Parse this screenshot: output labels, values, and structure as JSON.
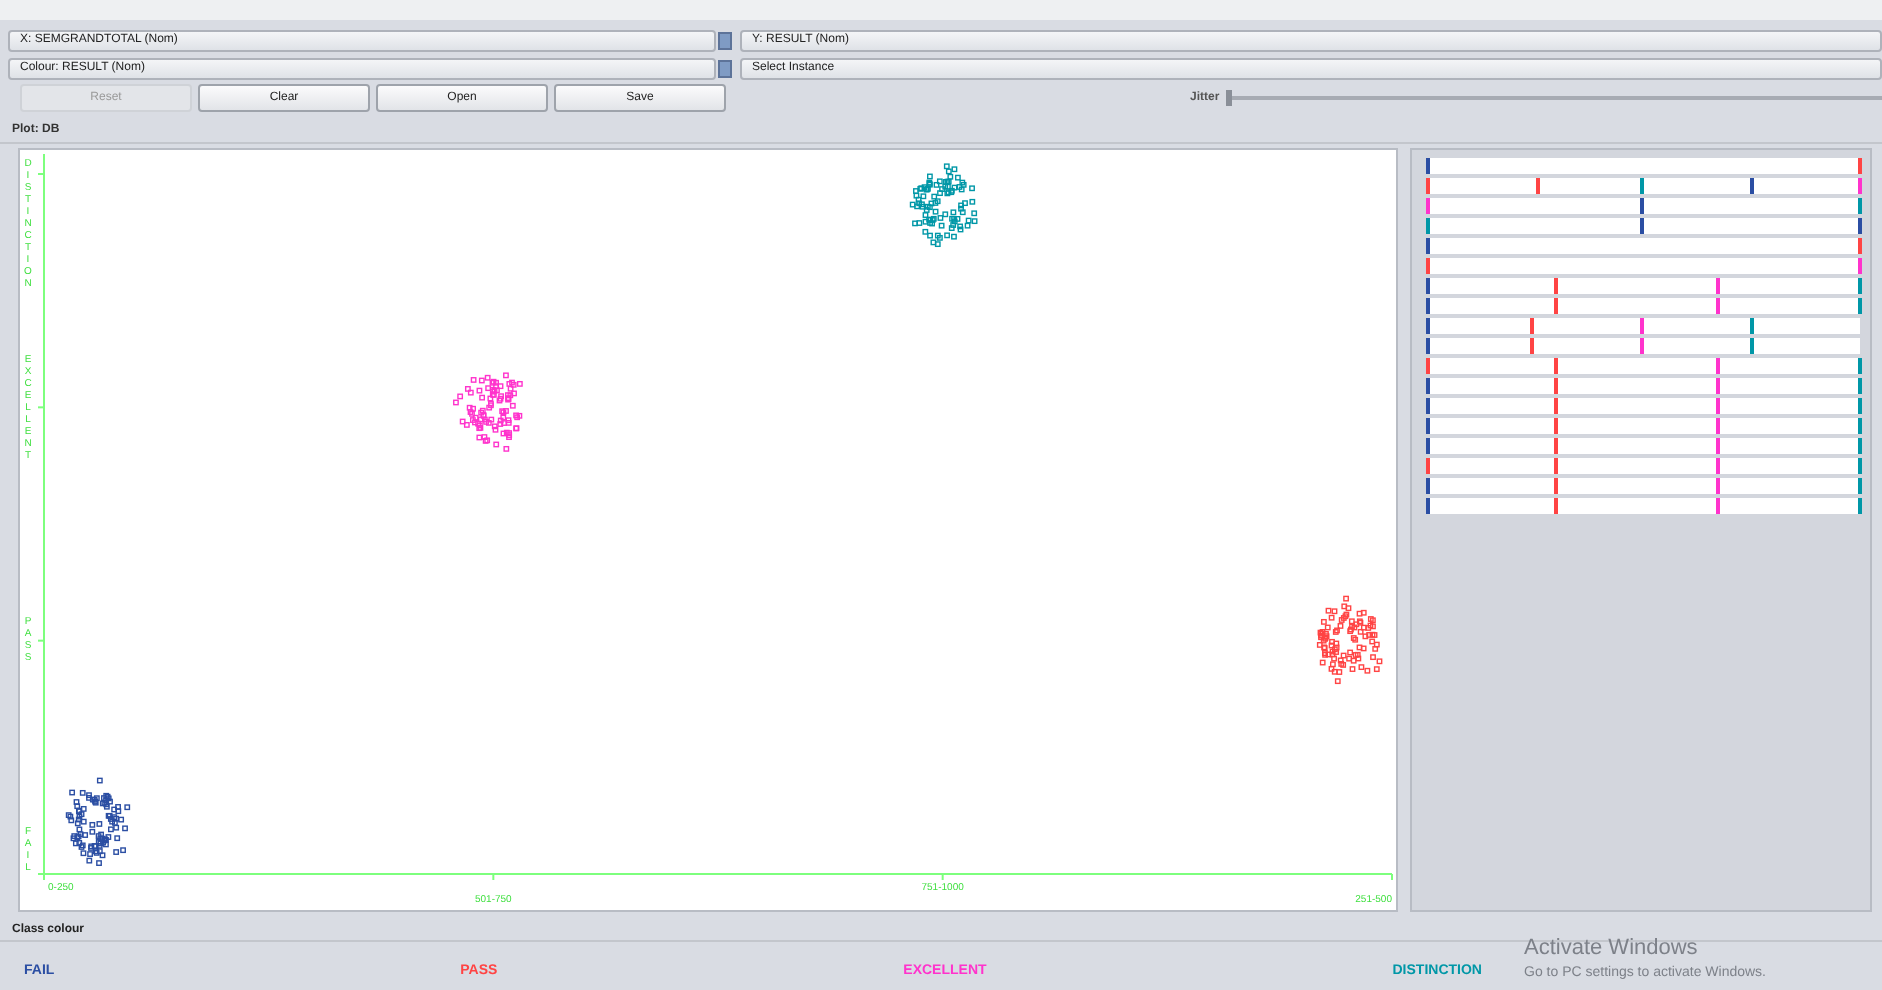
{
  "controls": {
    "x_axis": "X: SEMGRANDTOTAL (Nom)",
    "y_axis": "Y: RESULT (Nom)",
    "colour": "Colour: RESULT (Nom)",
    "instance": "Select Instance"
  },
  "buttons": [
    {
      "label": "Reset",
      "disabled": true
    },
    {
      "label": "Clear",
      "disabled": false
    },
    {
      "label": "Open",
      "disabled": false
    },
    {
      "label": "Save",
      "disabled": false
    }
  ],
  "jitter": {
    "label": "Jitter",
    "level": 0
  },
  "plot": {
    "title": "Plot: DB",
    "x_labels": [
      "0-250",
      "501-750",
      "751-1000",
      "251-500"
    ],
    "y_labels": [
      "DISTINCTION",
      "EXCELLENT",
      "PASS",
      "FAIL"
    ]
  },
  "class_colour": {
    "title": "Class colour",
    "items": [
      {
        "label": "FAIL",
        "color": "#2b4ea3"
      },
      {
        "label": "PASS",
        "color": "#ff4444"
      },
      {
        "label": "EXCELLENT",
        "color": "#ff33cc"
      },
      {
        "label": "DISTINCTION",
        "color": "#0097a7"
      }
    ]
  },
  "os_notice": {
    "title": "Activate Windows",
    "text": "Go to PC settings to activate Windows."
  }
}
